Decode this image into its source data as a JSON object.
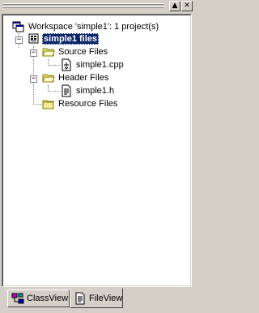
{
  "workspace": {
    "root_label": "Workspace 'simple1': 1 project(s)",
    "project_label": "simple1 files",
    "folders": [
      {
        "label": "Source Files",
        "files": [
          "simple1.cpp"
        ]
      },
      {
        "label": "Header Files",
        "files": [
          "simple1.h"
        ]
      },
      {
        "label": "Resource Files",
        "files": []
      }
    ]
  },
  "titlebar": {
    "restore_glyph": "▲",
    "close_glyph": "✕"
  },
  "tabs": [
    {
      "label": "ClassView",
      "active": false
    },
    {
      "label": "FileView",
      "active": true
    }
  ],
  "colors": {
    "selection": "#0a246a",
    "folder": "#f5e89a",
    "chrome": "#d4d0c8"
  }
}
